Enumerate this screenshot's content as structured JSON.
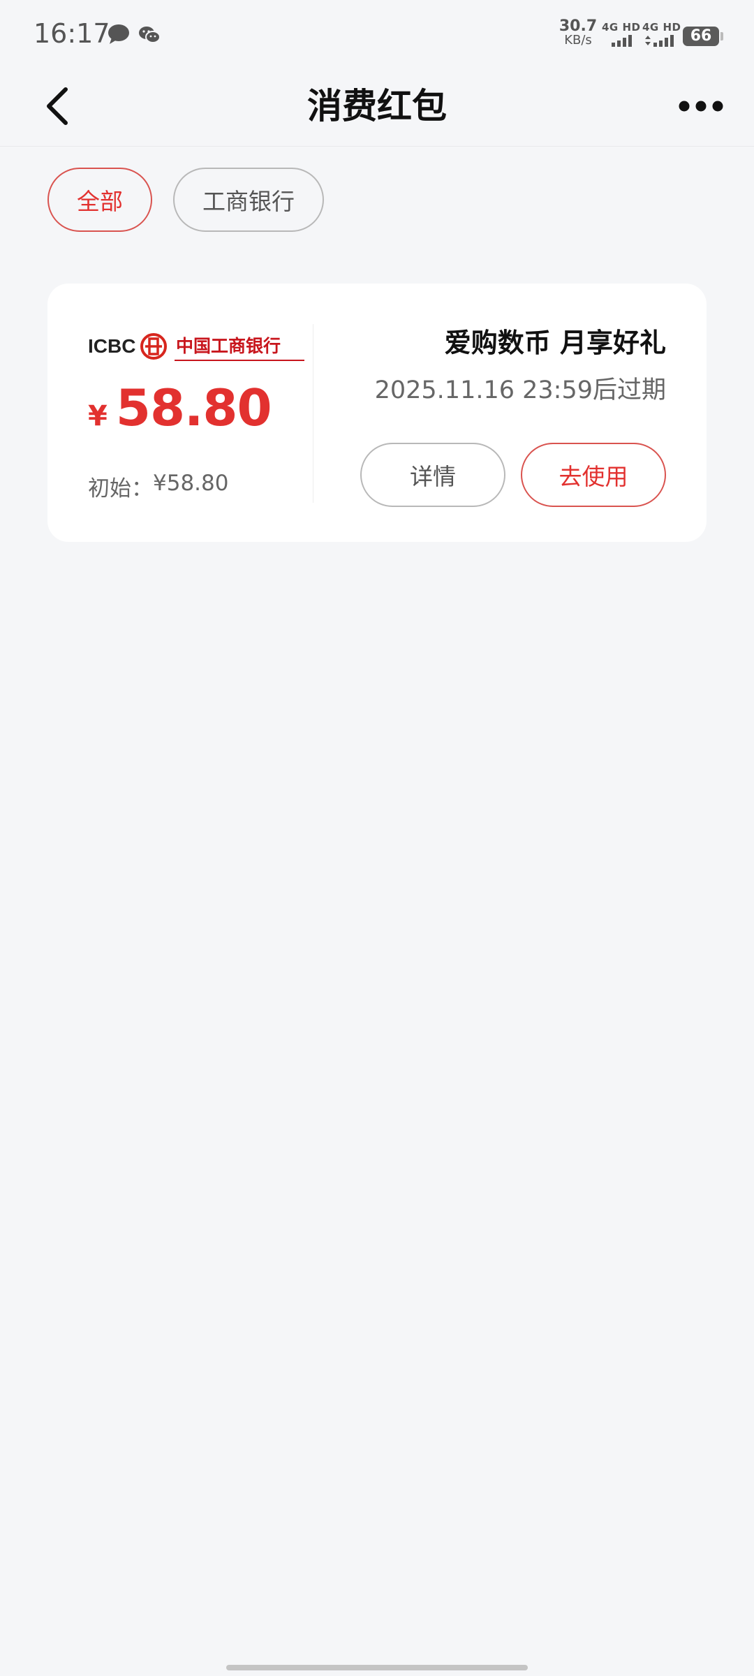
{
  "status_bar": {
    "time": "16:17",
    "net_speed_value": "30.7",
    "net_speed_unit": "KB/s",
    "signal1_label": "4G HD",
    "signal2_label": "4G HD",
    "battery": "66",
    "icons": [
      "message-icon",
      "wechat-icon",
      "signal-icon",
      "battery-icon"
    ]
  },
  "nav": {
    "title": "消费红包",
    "back_icon": "chevron-left-icon",
    "more_icon": "more-dots-icon"
  },
  "filters": [
    {
      "label": "全部",
      "active": true
    },
    {
      "label": "工商银行",
      "active": false
    }
  ],
  "coupon": {
    "bank_logo_latin": "ICBC",
    "bank_logo_cn": "中国工商银行",
    "currency": "¥",
    "amount": "58.80",
    "initial_label": "初始：",
    "initial_amount": "¥58.80",
    "title": "爱购数币 月享好礼",
    "expiry": "2025.11.16 23:59后过期",
    "detail_button": "详情",
    "use_button": "去使用"
  },
  "colors": {
    "accent": "#e2312f",
    "background": "#f5f6f8",
    "card": "#ffffff"
  }
}
